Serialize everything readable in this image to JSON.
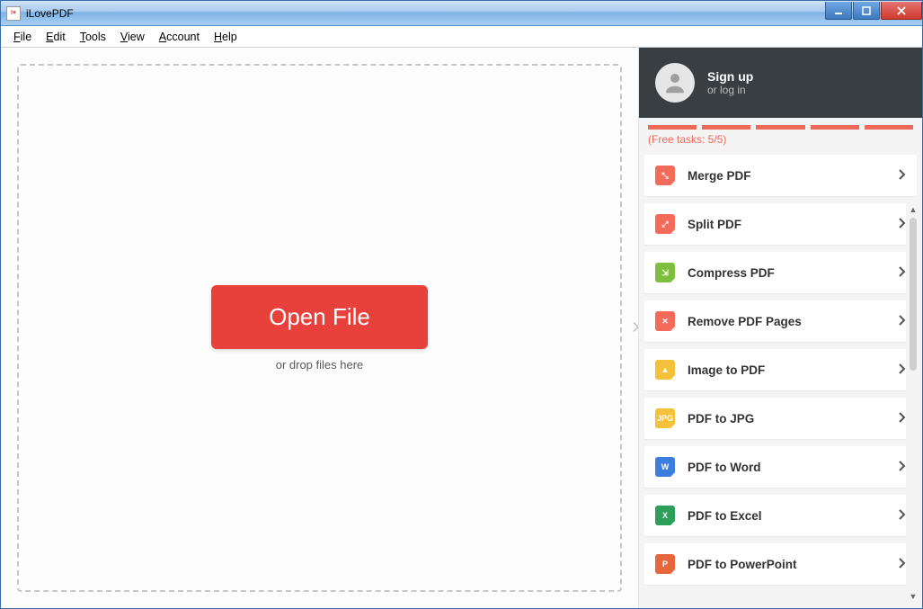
{
  "window": {
    "title": "iLovePDF"
  },
  "menu": {
    "file": "File",
    "edit": "Edit",
    "tools": "Tools",
    "view": "View",
    "account": "Account",
    "help": "Help"
  },
  "main": {
    "open_label": "Open File",
    "drop_hint": "or drop files here"
  },
  "sidebar": {
    "signup": "Sign up",
    "login": "or log in",
    "quota_text": "(Free tasks: 5/5)",
    "tools": [
      {
        "id": "merge",
        "label": "Merge PDF",
        "icon": "merge"
      },
      {
        "id": "split",
        "label": "Split PDF",
        "icon": "split"
      },
      {
        "id": "compress",
        "label": "Compress PDF",
        "icon": "compress"
      },
      {
        "id": "remove",
        "label": "Remove PDF Pages",
        "icon": "remove"
      },
      {
        "id": "img2pdf",
        "label": "Image to PDF",
        "icon": "img2pdf"
      },
      {
        "id": "pdf2jpg",
        "label": "PDF to JPG",
        "icon": "pdf2jpg"
      },
      {
        "id": "pdf2word",
        "label": "PDF to Word",
        "icon": "pdf2word"
      },
      {
        "id": "pdf2excel",
        "label": "PDF to Excel",
        "icon": "pdf2excel"
      },
      {
        "id": "pdf2ppt",
        "label": "PDF to PowerPoint",
        "icon": "pdf2ppt"
      }
    ]
  },
  "icon_glyph": {
    "merge": "⤡",
    "split": "⤢",
    "compress": "⇲",
    "remove": "✕",
    "img2pdf": "▲",
    "pdf2jpg": "JPG",
    "pdf2word": "W",
    "pdf2excel": "X",
    "pdf2ppt": "P"
  }
}
